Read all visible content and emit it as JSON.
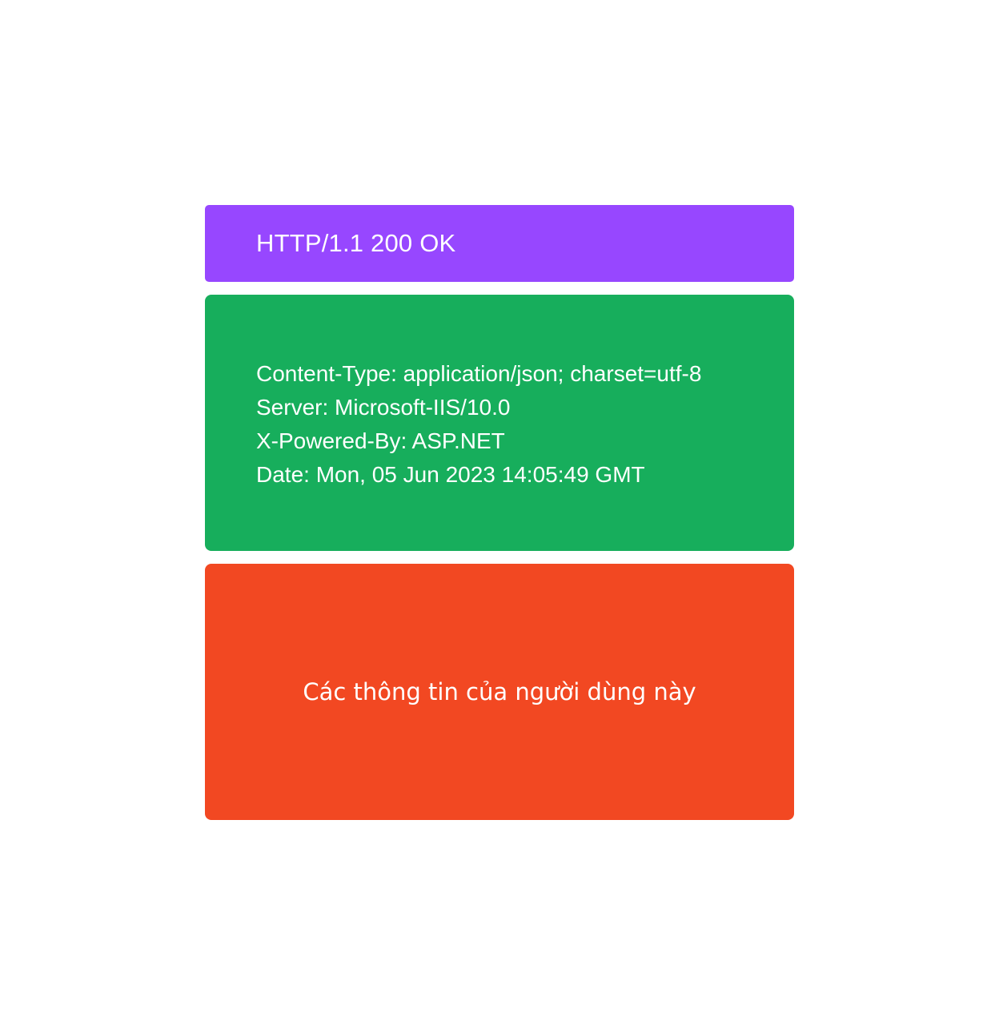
{
  "status_line": {
    "text": "HTTP/1.1 200 OK",
    "color": "#9747ff"
  },
  "headers": {
    "color": "#17ae5c",
    "lines": [
      "Content-Type: application/json; charset=utf-8",
      "Server: Microsoft-IIS/10.0",
      "X-Powered-By: ASP.NET",
      "Date: Mon, 05 Jun 2023 14:05:49 GMT"
    ]
  },
  "body": {
    "text": "Các thông tin của người dùng này",
    "color": "#f24822"
  }
}
